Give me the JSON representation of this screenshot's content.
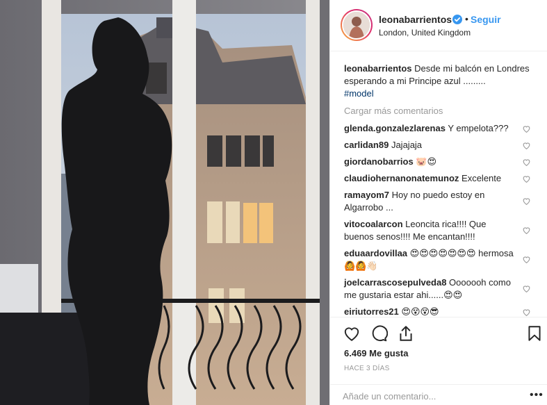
{
  "post": {
    "username": "leonabarrientos",
    "verified": true,
    "follow_label": "Seguir",
    "separator": "•",
    "location": "London, United Kingdom",
    "caption": {
      "username": "leonabarrientos",
      "text": "Desde mi balcón en Londres esperando a mi Principe azul .........",
      "hashtag": "#model"
    },
    "load_more_label": "Cargar más comentarios",
    "comments": [
      {
        "username": "glenda.gonzalezlarenas",
        "text": "Y empelota???"
      },
      {
        "username": "carlidan89",
        "text": "Jajajaja"
      },
      {
        "username": "giordanobarrios",
        "text": "🐷😍"
      },
      {
        "username": "claudiohernanonatemunoz",
        "text": "Excelente"
      },
      {
        "username": "ramayom7",
        "text": "Hoy no puedo estoy en Algarrobo ..."
      },
      {
        "username": "vitocoalarcon",
        "text": "Leoncita rica!!!! Que buenos senos!!!! Me encantan!!!!"
      },
      {
        "username": "eduaardovillaa",
        "text": "😍😍😍😍😍😍😍 hermosa🙆🙆👋🏻"
      },
      {
        "username": "joelcarrascosepulveda8",
        "text": "Ooooooh como me gustaria estar ahi......😍😍"
      },
      {
        "username": "eiriutorres21",
        "text": "😍😵😵😎"
      }
    ],
    "likes_label": "6.469 Me gusta",
    "time_label": "HACE 3 DÍAS",
    "comment_placeholder": "Añade un comentario...",
    "more_options": "•••"
  },
  "icons": {
    "verified": "verified-badge-icon",
    "heart": "heart-icon",
    "comment": "comment-icon",
    "share": "share-icon",
    "save": "bookmark-icon",
    "comment_like": "heart-outline-icon"
  },
  "colors": {
    "link_blue": "#3897f0",
    "hashtag": "#003569",
    "muted": "#999999",
    "text": "#262626",
    "border": "#efefef"
  }
}
